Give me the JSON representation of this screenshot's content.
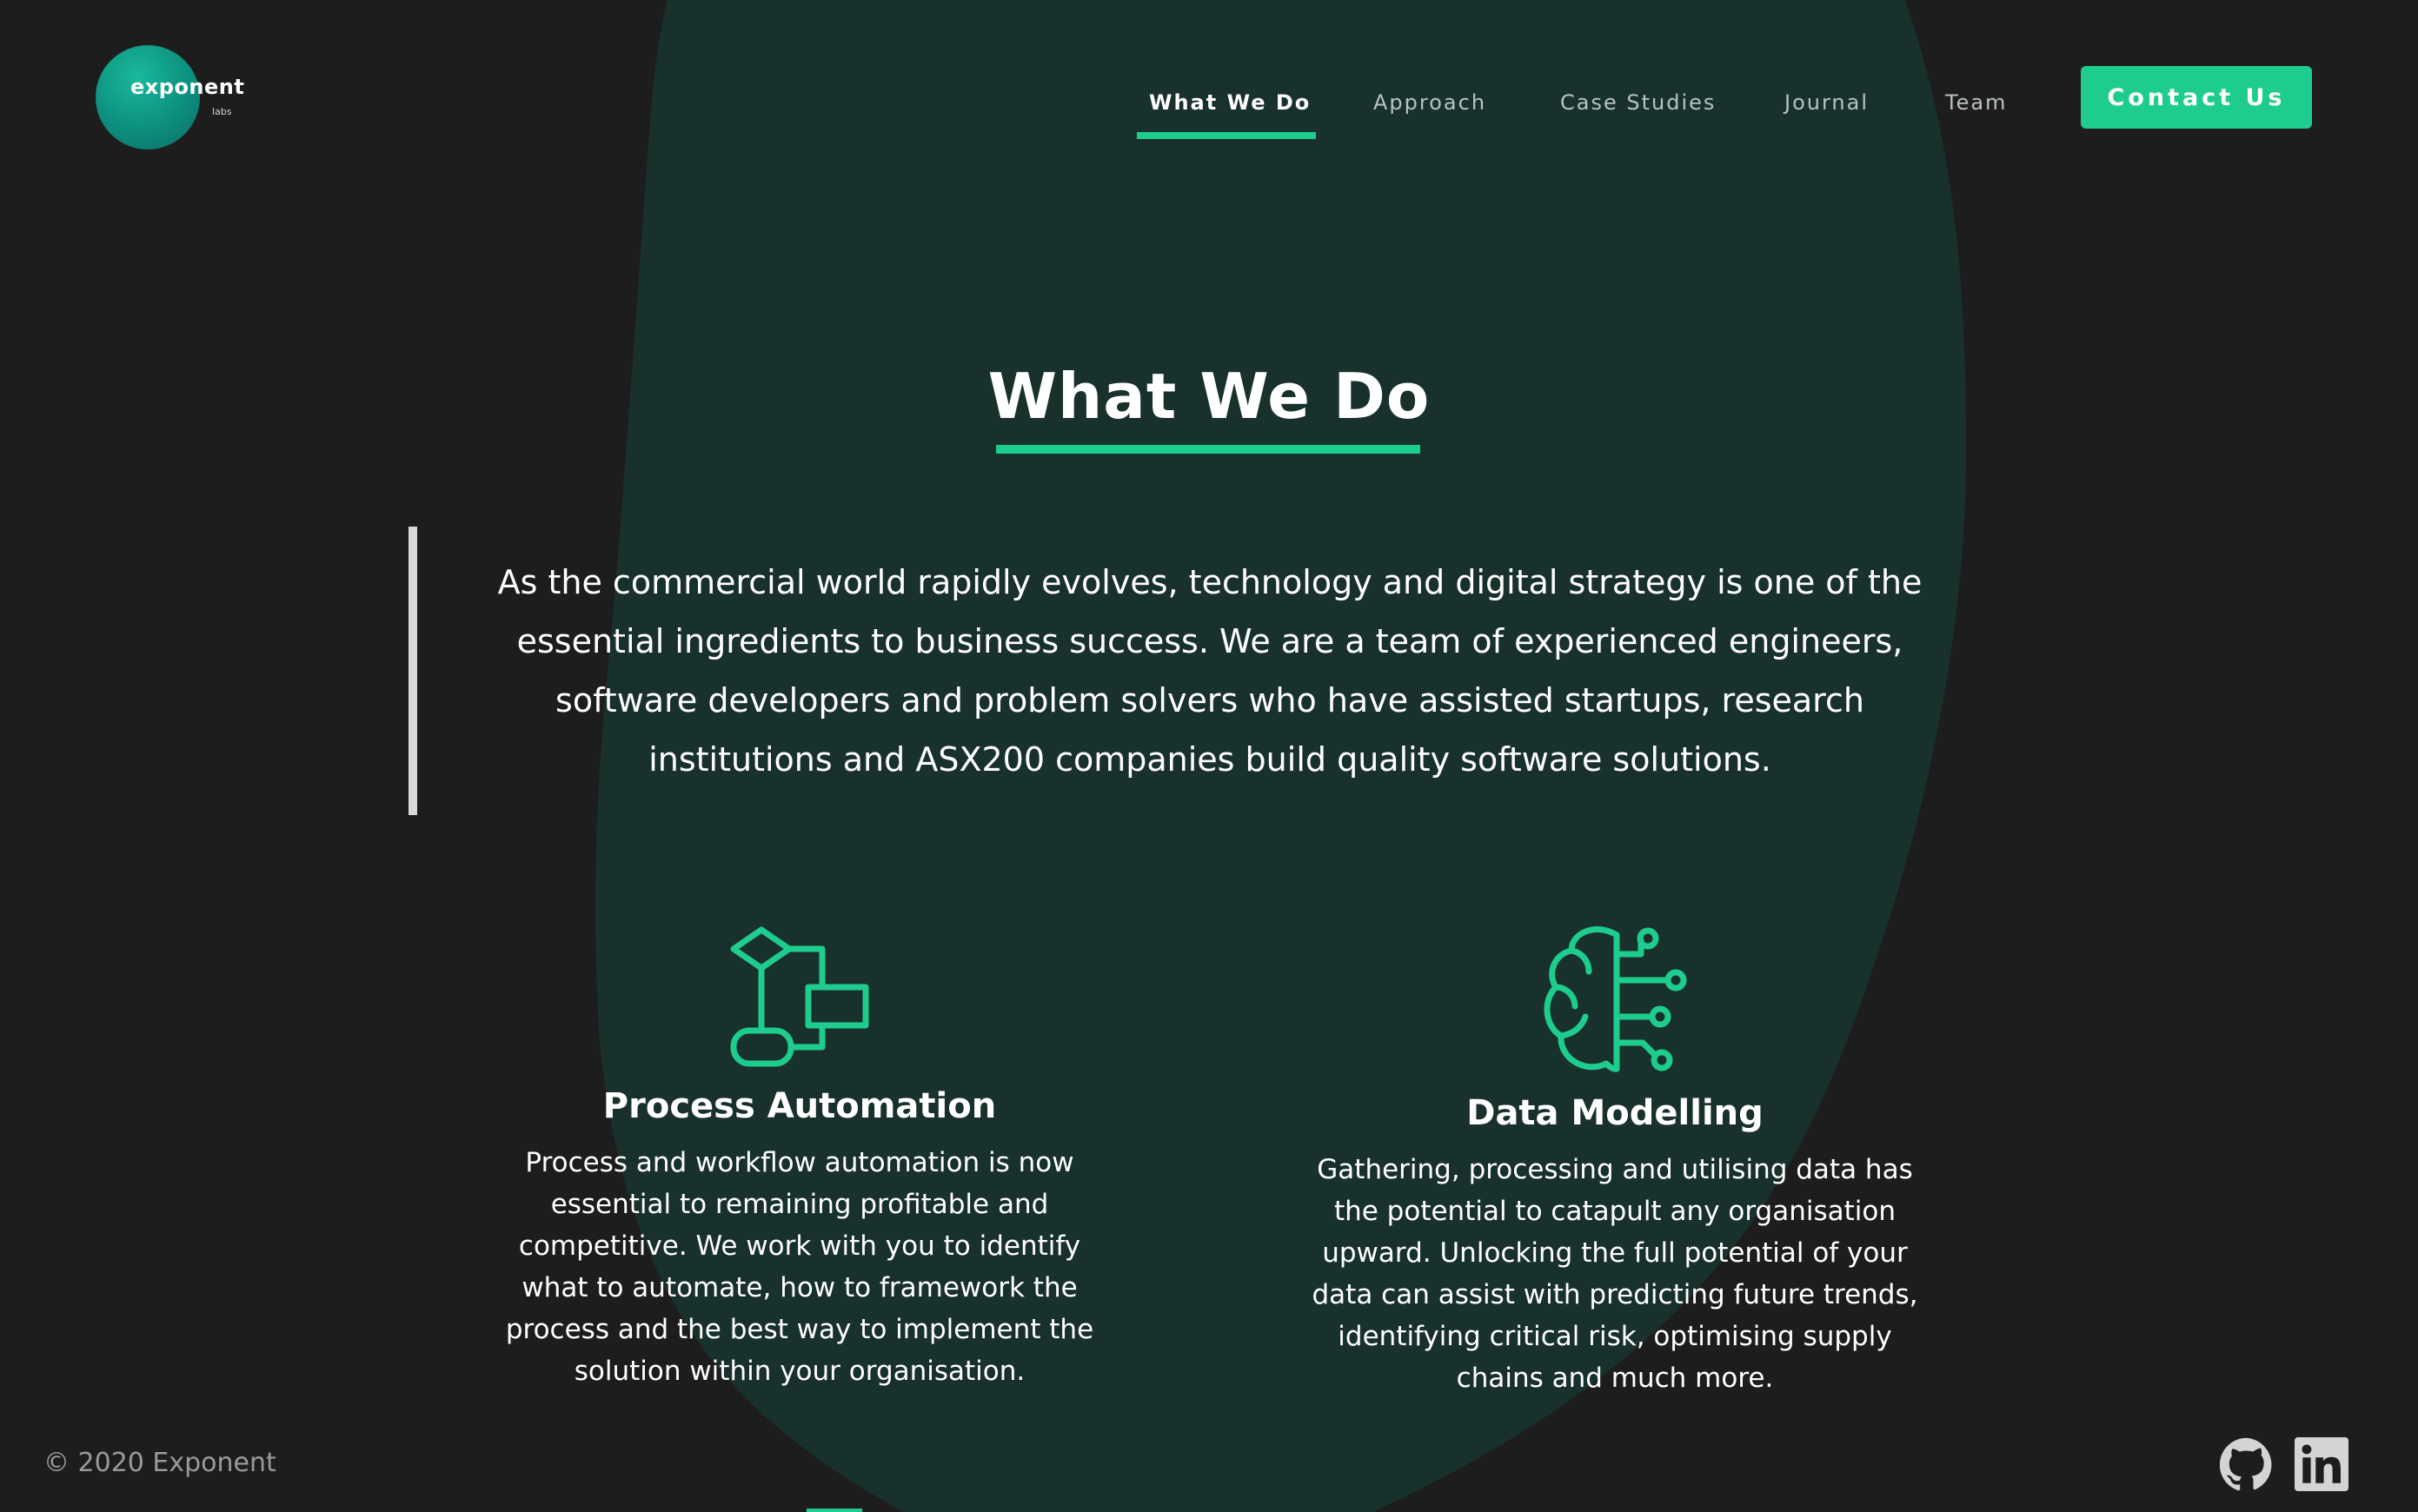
{
  "brand": {
    "name": "exponent",
    "sub": "labs"
  },
  "nav": {
    "items": [
      {
        "label": "What We Do",
        "active": true
      },
      {
        "label": "Approach"
      },
      {
        "label": "Case Studies"
      },
      {
        "label": "Journal"
      },
      {
        "label": "Team"
      }
    ],
    "contact_label": "Contact Us"
  },
  "hero": {
    "title": "What We Do",
    "intro": "As the commercial world rapidly evolves, technology and digital strategy is one of the essential ingredients to business success. We are a team of experienced engineers, software developers and problem solvers who have assisted startups, research institutions and ASX200 companies build quality software solutions."
  },
  "services": [
    {
      "icon": "flowchart-icon",
      "title": "Process Automation",
      "text": "Process and workflow automation is now essential to remaining profitable and competitive. We work with you to identify what to automate, how to framework the process and the best way to implement the solution within your organisation."
    },
    {
      "icon": "brain-circuit-icon",
      "title": "Data Modelling",
      "text": "Gathering, processing and utilising data has the potential to catapult any organisation upward. Unlocking the full potential of your data can assist with predicting future trends, identifying critical risk, optimising supply chains and much more."
    }
  ],
  "footer": {
    "copyright": "© 2020 Exponent",
    "social": [
      "github-icon",
      "linkedin-icon"
    ]
  },
  "colors": {
    "background": "#1d1d1d",
    "blob": "#19312d",
    "accent": "#1ecd8e",
    "text": "#ffffff"
  }
}
